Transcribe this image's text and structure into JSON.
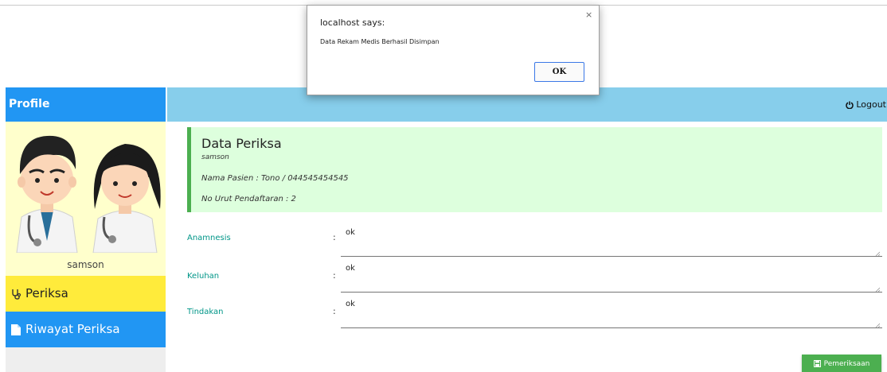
{
  "sidebar": {
    "header": "Profile",
    "username": "samson",
    "items": [
      {
        "label": "Periksa",
        "icon": "stethoscope-icon",
        "color": "#FFEB3B"
      },
      {
        "label": "Riwayat Periksa",
        "icon": "document-icon",
        "color": "#2196F3"
      }
    ]
  },
  "topbar": {
    "logout_label": "Logout",
    "color": "#87CEEB"
  },
  "card": {
    "title": "Data Periksa",
    "user": "samson",
    "patient": "Nama Pasien : Tono / 044545454545",
    "queue": "No Urut Pendaftaran : 2"
  },
  "form": {
    "colon": ":",
    "fields": [
      {
        "label": "Anamnesis",
        "value": "ok"
      },
      {
        "label": "Keluhan",
        "value": "ok"
      },
      {
        "label": "Tindakan",
        "value": "ok"
      }
    ],
    "submit_label": "Pemeriksaan"
  },
  "dialog": {
    "title": "localhost says:",
    "message": "Data Rekam Medis Berhasil Disimpan",
    "ok_label": "OK",
    "close_glyph": "×"
  }
}
